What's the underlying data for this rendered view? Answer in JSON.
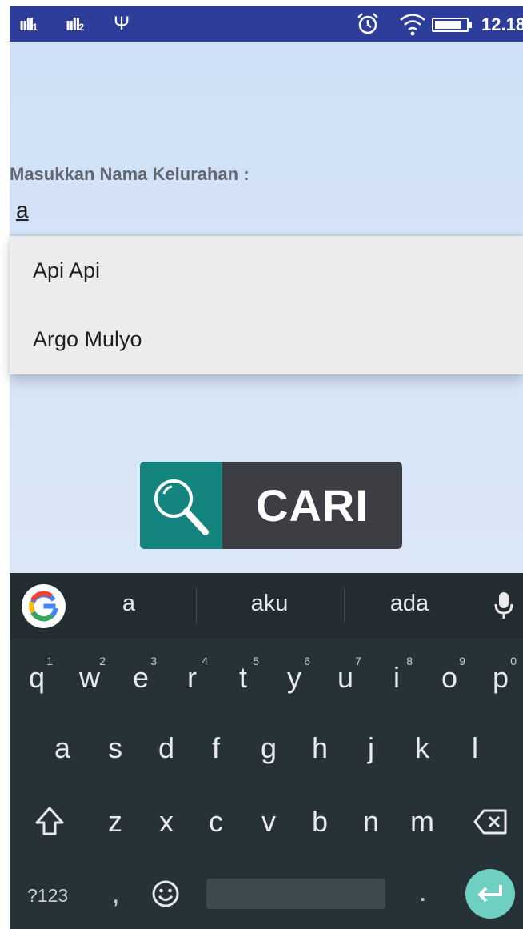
{
  "status_bar": {
    "signal_1": "ııll",
    "sim_1": "1",
    "signal_2": "ııll",
    "sim_2": "2",
    "usb_symbol": "Ψ",
    "time": "12.18",
    "icons": [
      "signal-icon",
      "usb-icon",
      "alarm-icon",
      "wifi-icon",
      "battery-icon"
    ],
    "battery_level": 0.85,
    "background": "#2e3d9a"
  },
  "form": {
    "label": "Masukkan Nama Kelurahan :",
    "input_value": "a"
  },
  "autocomplete": {
    "items": [
      "Api Api",
      "Argo Mulyo"
    ]
  },
  "search_button": {
    "label": "CARI",
    "icon": "search-icon",
    "icon_color": "#14847e"
  },
  "keyboard": {
    "suggestions": [
      "a",
      "aku",
      "ada"
    ],
    "row1": [
      {
        "key": "q",
        "hint": "1"
      },
      {
        "key": "w",
        "hint": "2"
      },
      {
        "key": "e",
        "hint": "3"
      },
      {
        "key": "r",
        "hint": "4"
      },
      {
        "key": "t",
        "hint": "5"
      },
      {
        "key": "y",
        "hint": "6"
      },
      {
        "key": "u",
        "hint": "7"
      },
      {
        "key": "i",
        "hint": "8"
      },
      {
        "key": "o",
        "hint": "9"
      },
      {
        "key": "p",
        "hint": "0"
      }
    ],
    "row2": [
      "a",
      "s",
      "d",
      "f",
      "g",
      "h",
      "j",
      "k",
      "l"
    ],
    "row3": [
      "z",
      "x",
      "c",
      "v",
      "b",
      "n",
      "m"
    ],
    "symbols_key": "?123",
    "comma_key": ",",
    "period_key": ".",
    "icons": [
      "google-icon",
      "mic-icon",
      "shift-icon",
      "backspace-icon",
      "emoji-icon",
      "enter-icon"
    ],
    "enter_color": "#6fd0c2"
  }
}
